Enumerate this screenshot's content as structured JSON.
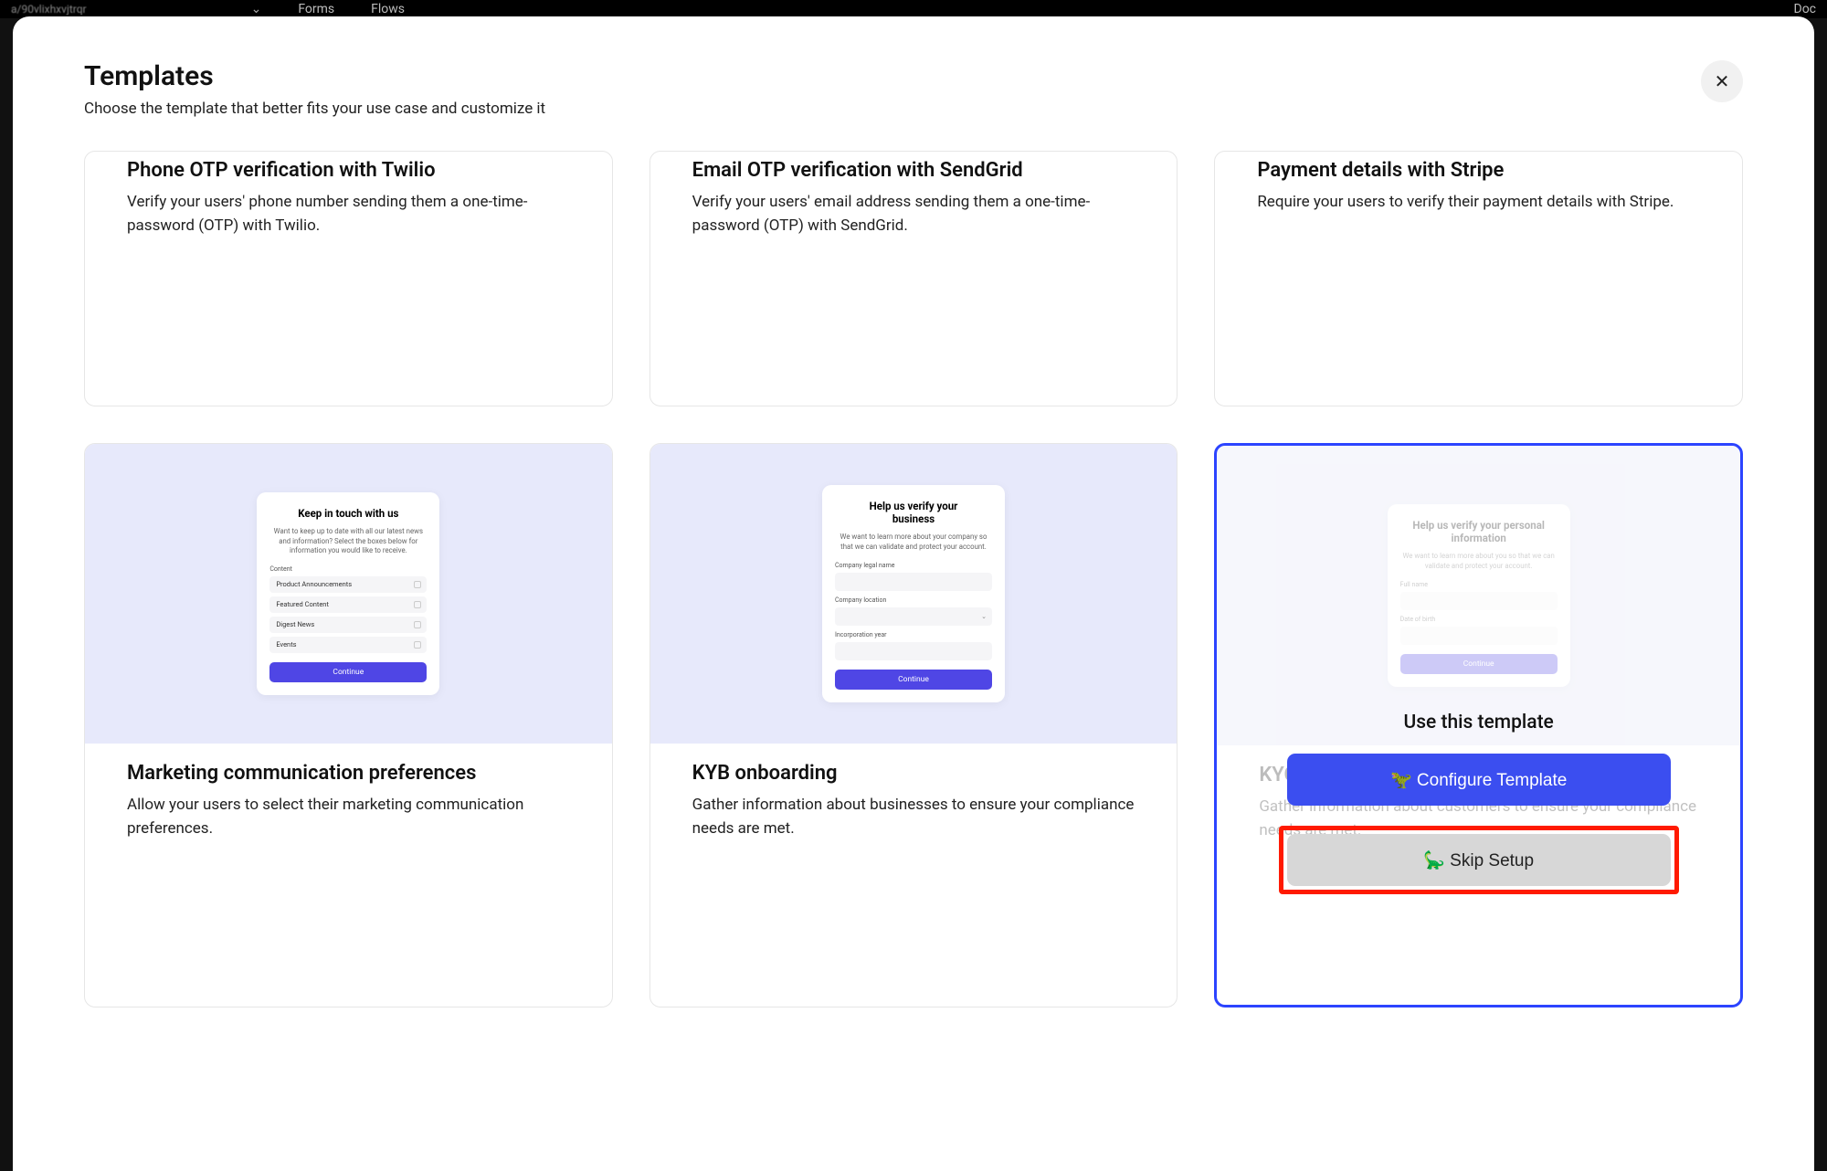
{
  "bg_nav": {
    "text": "a/90vlixhxvjtrqr",
    "forms": "Forms",
    "flows": "Flows",
    "docs": "Doc"
  },
  "modal": {
    "title": "Templates",
    "subtitle": "Choose the template that better fits your use case and customize it"
  },
  "row1": [
    {
      "title": "Phone OTP verification with Twilio",
      "desc": "Verify your users' phone number sending them a one-time-password (OTP) with Twilio."
    },
    {
      "title": "Email OTP verification with SendGrid",
      "desc": "Verify your users' email address sending them a one-time-password (OTP) with SendGrid."
    },
    {
      "title": "Payment details with Stripe",
      "desc": "Require your users to verify their payment details with Stripe."
    }
  ],
  "row2": [
    {
      "title": "Marketing communication preferences",
      "desc": "Allow your users to select their marketing communication preferences.",
      "preview": {
        "heading": "Keep in touch with us",
        "sub": "Want to keep up to date with all our latest news and information? Select the boxes below for information you would like to receive.",
        "section": "Content",
        "items": [
          "Product Announcements",
          "Featured Content",
          "Digest News",
          "Events"
        ],
        "button": "Continue"
      }
    },
    {
      "title": "KYB onboarding",
      "desc": "Gather information about businesses to ensure your compliance needs are met.",
      "preview": {
        "heading": "Help us verify your business",
        "sub": "We want to learn more about your company so that we can validate and protect your account.",
        "fields": [
          "Company legal name",
          "Company location",
          "Incorporation year"
        ],
        "button": "Continue"
      }
    },
    {
      "title": "KYC onboarding",
      "desc": "Gather information about customers to ensure your compliance needs are met.",
      "preview": {
        "heading": "Help us verify your personal information",
        "sub": "We want to learn more about you so that we can validate and protect your account.",
        "fields": [
          "Full name",
          "Date of birth"
        ],
        "button": "Continue"
      },
      "overlay": {
        "title": "Use this template",
        "configure": "🦖 Configure Template",
        "skip": "🦕 Skip Setup"
      }
    }
  ]
}
